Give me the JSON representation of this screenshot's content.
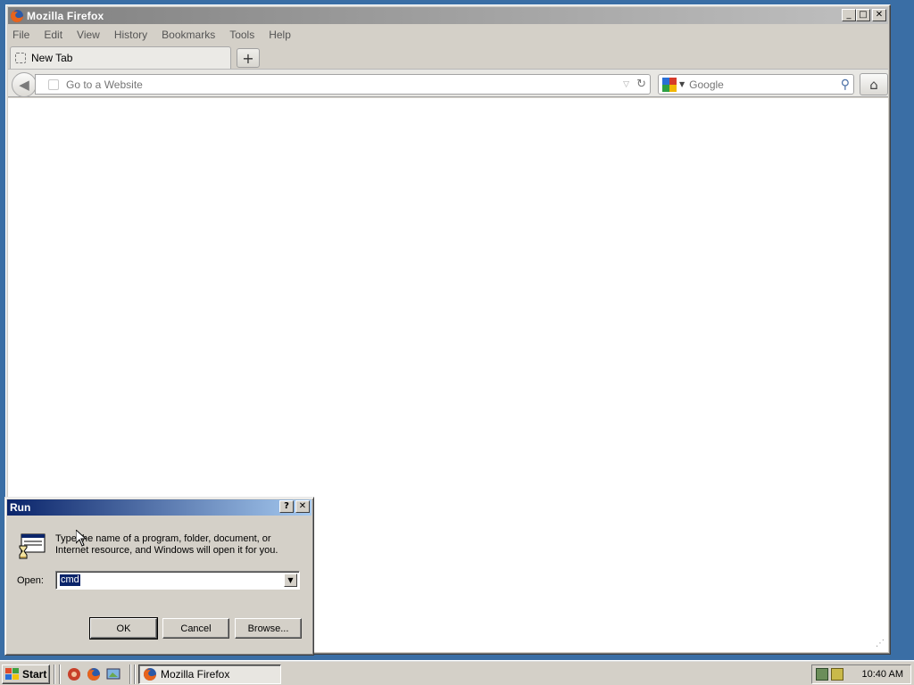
{
  "firefox": {
    "title": "Mozilla Firefox",
    "menu": [
      "File",
      "Edit",
      "View",
      "History",
      "Bookmarks",
      "Tools",
      "Help"
    ],
    "tab": {
      "label": "New Tab"
    },
    "newtab_symbol": "+",
    "url_placeholder": "Go to a Website",
    "search_placeholder": "Google",
    "window_controls": {
      "minimize": "_",
      "maximize": "□",
      "close": "✕"
    }
  },
  "run_dialog": {
    "title": "Run",
    "help_symbol": "?",
    "close_symbol": "✕",
    "description": "Type the name of a program, folder, document, or Internet resource, and Windows will open it for you.",
    "open_label": "Open:",
    "open_value": "cmd",
    "ok_label": "OK",
    "cancel_label": "Cancel",
    "browse_label": "Browse..."
  },
  "taskbar": {
    "start_label": "Start",
    "task_label": "Mozilla Firefox",
    "clock": "10:40 AM",
    "quick_launch": [
      "media-player-icon",
      "firefox-icon",
      "show-desktop-icon"
    ]
  },
  "colors": {
    "desktop": "#3a6ea5",
    "active_title": "#0a246a",
    "inactive_title": "#808080",
    "chrome_face": "#d4d0c8"
  }
}
